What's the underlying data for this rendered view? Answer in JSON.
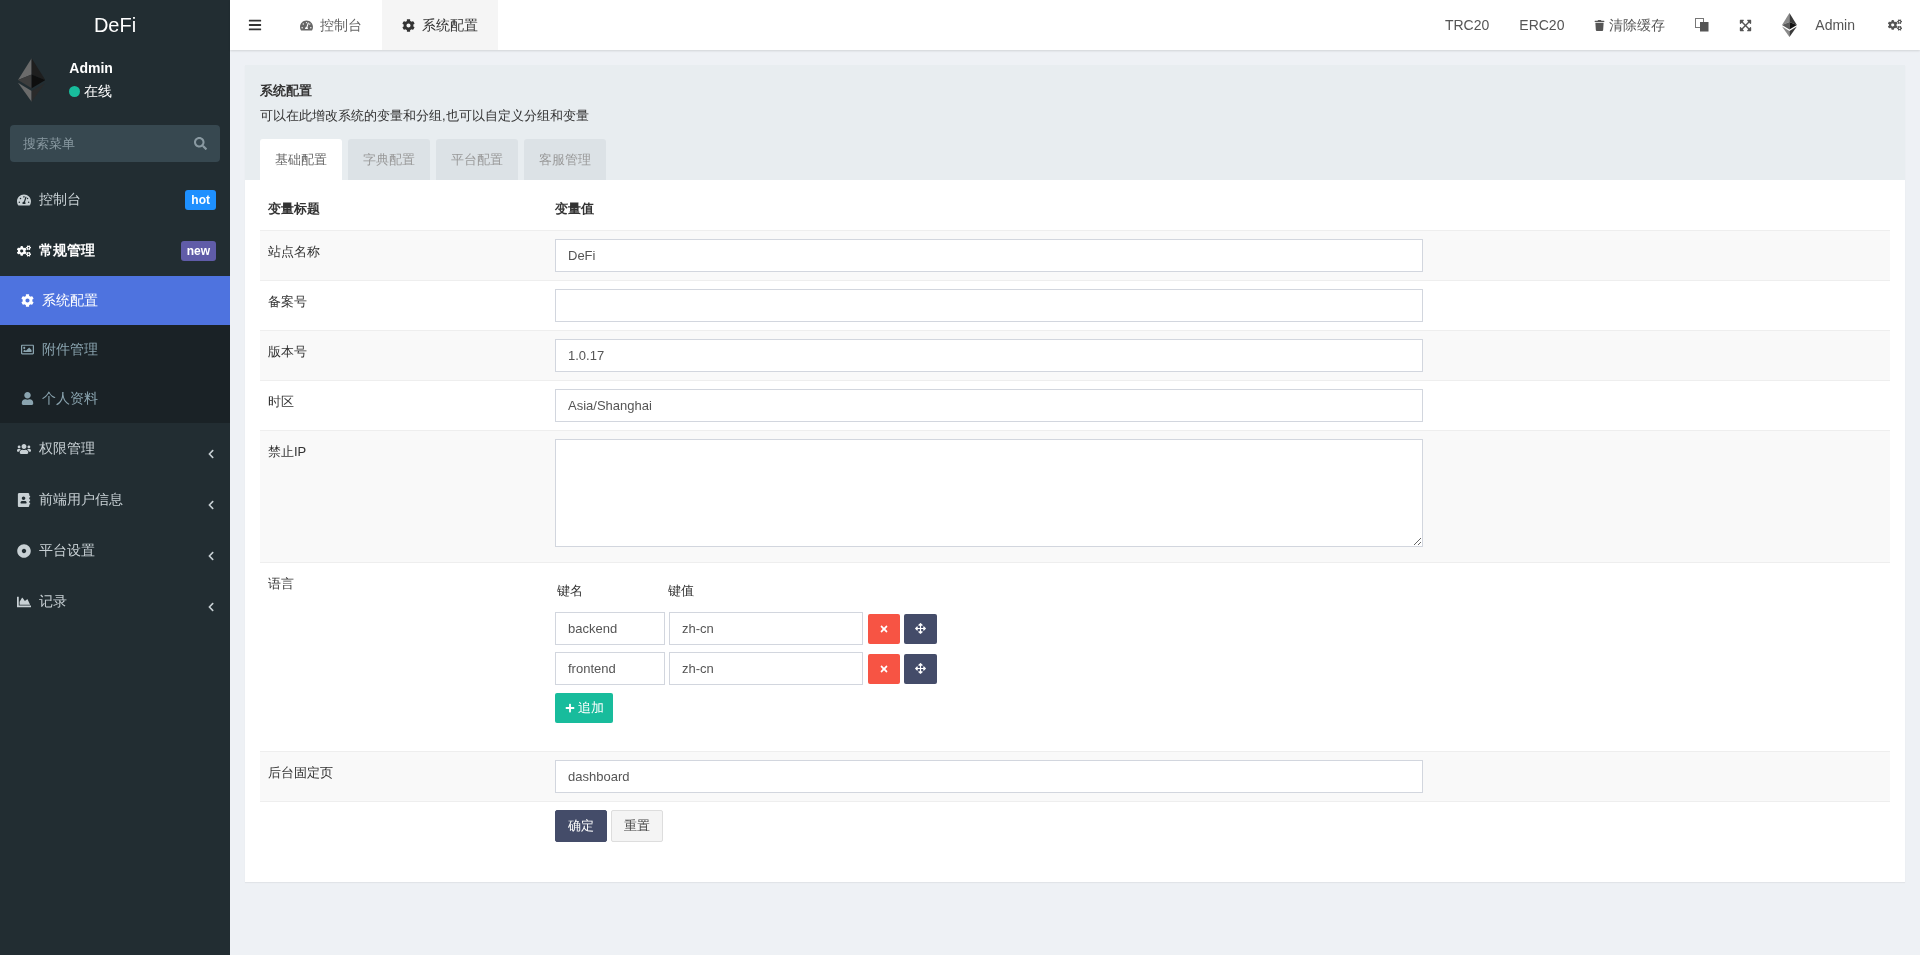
{
  "sidebar": {
    "logo": "DeFi",
    "user": {
      "name": "Admin",
      "status": "在线",
      "online": true
    },
    "search": {
      "placeholder": "搜索菜单"
    },
    "items": [
      {
        "label": "控制台",
        "badge": {
          "text": "hot",
          "color": "#1e90ff"
        },
        "selected": false
      },
      {
        "label": "常规管理",
        "badge": {
          "text": "new",
          "color": "#605ca8"
        },
        "selected": false,
        "expanded": true,
        "children": [
          {
            "label": "系统配置",
            "selected": true
          },
          {
            "label": "附件管理",
            "selected": false
          },
          {
            "label": "个人资料",
            "selected": false
          }
        ]
      },
      {
        "label": "权限管理",
        "selected": false,
        "expanded": false
      },
      {
        "label": "前端用户信息",
        "selected": false,
        "expanded": false
      },
      {
        "label": "平台设置",
        "selected": false,
        "expanded": false
      },
      {
        "label": "记录",
        "selected": false,
        "expanded": false
      }
    ]
  },
  "topbar": {
    "tabs": [
      {
        "label": "控制台",
        "selected": false
      },
      {
        "label": "系统配置",
        "selected": true
      }
    ],
    "links": [
      "TRC20",
      "ERC20"
    ],
    "clear_cache": "清除缓存",
    "user": "Admin"
  },
  "panel": {
    "title": "系统配置",
    "description": "可以在此增改系统的变量和分组,也可以自定义分组和变量",
    "tabs": [
      {
        "label": "基础配置",
        "selected": true
      },
      {
        "label": "字典配置",
        "selected": false
      },
      {
        "label": "平台配置",
        "selected": false
      },
      {
        "label": "客服管理",
        "selected": false
      }
    ],
    "columns": [
      "变量标题",
      "变量值"
    ],
    "rows": [
      {
        "kind": "input",
        "label": "站点名称",
        "value": "DeFi"
      },
      {
        "kind": "input",
        "label": "备案号",
        "value": ""
      },
      {
        "kind": "input",
        "label": "版本号",
        "value": "1.0.17"
      },
      {
        "kind": "input",
        "label": "时区",
        "value": "Asia/Shanghai"
      },
      {
        "kind": "textarea",
        "label": "禁止IP",
        "value": ""
      },
      {
        "kind": "keyvalue",
        "label": "语言",
        "headers": [
          "键名",
          "键值"
        ],
        "pairs": [
          {
            "key": "backend",
            "value": "zh-cn"
          },
          {
            "key": "frontend",
            "value": "zh-cn"
          }
        ],
        "add": "追加"
      },
      {
        "kind": "input",
        "label": "后台固定页",
        "value": "dashboard"
      }
    ],
    "buttons": [
      {
        "label": "确定",
        "kind": "primary"
      },
      {
        "label": "重置",
        "kind": "default"
      }
    ]
  }
}
